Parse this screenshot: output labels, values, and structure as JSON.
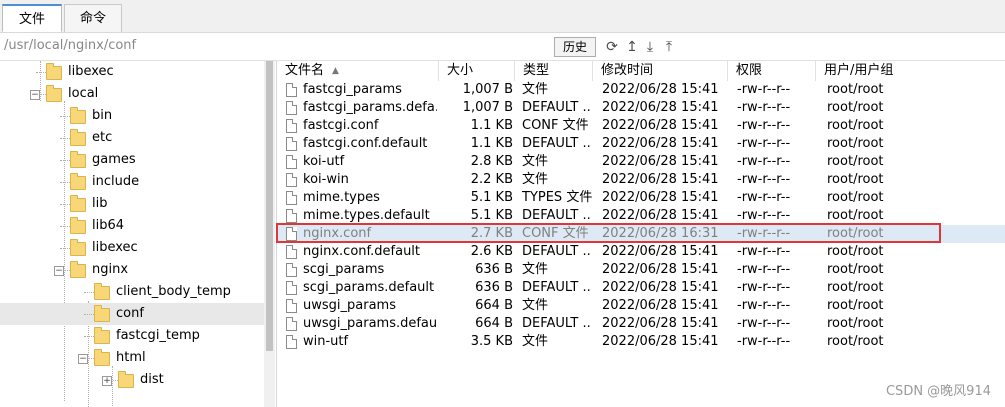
{
  "tabs": [
    {
      "label": "文件",
      "active": true
    },
    {
      "label": "命令",
      "active": false
    }
  ],
  "path": {
    "value": "/usr/local/nginx/conf"
  },
  "toolbar": {
    "history_label": "历史",
    "icons": [
      "refresh-icon",
      "upload-icon",
      "download-icon",
      "upload-alt-icon"
    ]
  },
  "tree": {
    "items": [
      {
        "label": "libexec",
        "depth": 1,
        "expander": "none"
      },
      {
        "label": "local",
        "depth": 1,
        "expander": "minus"
      },
      {
        "label": "bin",
        "depth": 2,
        "expander": "none"
      },
      {
        "label": "etc",
        "depth": 2,
        "expander": "none"
      },
      {
        "label": "games",
        "depth": 2,
        "expander": "none"
      },
      {
        "label": "include",
        "depth": 2,
        "expander": "none"
      },
      {
        "label": "lib",
        "depth": 2,
        "expander": "none"
      },
      {
        "label": "lib64",
        "depth": 2,
        "expander": "none"
      },
      {
        "label": "libexec",
        "depth": 2,
        "expander": "none"
      },
      {
        "label": "nginx",
        "depth": 2,
        "expander": "minus"
      },
      {
        "label": "client_body_temp",
        "depth": 3,
        "expander": "none"
      },
      {
        "label": "conf",
        "depth": 3,
        "expander": "none",
        "selected": true
      },
      {
        "label": "fastcgi_temp",
        "depth": 3,
        "expander": "none"
      },
      {
        "label": "html",
        "depth": 3,
        "expander": "minus"
      },
      {
        "label": "dist",
        "depth": 4,
        "expander": "plus"
      }
    ]
  },
  "columns": {
    "name": "文件名",
    "size": "大小",
    "type": "类型",
    "mtime": "修改时间",
    "perm": "权限",
    "owner": "用户/用户组"
  },
  "files": [
    {
      "name": "fastcgi_params",
      "size": "1,007 B",
      "type": "文件",
      "mtime": "2022/06/28 15:41",
      "perm": "-rw-r--r--",
      "owner": "root/root"
    },
    {
      "name": "fastcgi_params.defa...",
      "size": "1,007 B",
      "type": "DEFAULT ...",
      "mtime": "2022/06/28 15:41",
      "perm": "-rw-r--r--",
      "owner": "root/root"
    },
    {
      "name": "fastcgi.conf",
      "size": "1.1 KB",
      "type": "CONF 文件",
      "mtime": "2022/06/28 15:41",
      "perm": "-rw-r--r--",
      "owner": "root/root"
    },
    {
      "name": "fastcgi.conf.default",
      "size": "1.1 KB",
      "type": "DEFAULT ...",
      "mtime": "2022/06/28 15:41",
      "perm": "-rw-r--r--",
      "owner": "root/root"
    },
    {
      "name": "koi-utf",
      "size": "2.8 KB",
      "type": "文件",
      "mtime": "2022/06/28 15:41",
      "perm": "-rw-r--r--",
      "owner": "root/root"
    },
    {
      "name": "koi-win",
      "size": "2.2 KB",
      "type": "文件",
      "mtime": "2022/06/28 15:41",
      "perm": "-rw-r--r--",
      "owner": "root/root"
    },
    {
      "name": "mime.types",
      "size": "5.1 KB",
      "type": "TYPES 文件",
      "mtime": "2022/06/28 15:41",
      "perm": "-rw-r--r--",
      "owner": "root/root"
    },
    {
      "name": "mime.types.default",
      "size": "5.1 KB",
      "type": "DEFAULT ...",
      "mtime": "2022/06/28 15:41",
      "perm": "-rw-r--r--",
      "owner": "root/root"
    },
    {
      "name": "nginx.conf",
      "size": "2.7 KB",
      "type": "CONF 文件",
      "mtime": "2022/06/28 16:31",
      "perm": "-rw-r--r--",
      "owner": "root/root",
      "highlight": true
    },
    {
      "name": "nginx.conf.default",
      "size": "2.6 KB",
      "type": "DEFAULT ...",
      "mtime": "2022/06/28 15:41",
      "perm": "-rw-r--r--",
      "owner": "root/root"
    },
    {
      "name": "scgi_params",
      "size": "636 B",
      "type": "文件",
      "mtime": "2022/06/28 15:41",
      "perm": "-rw-r--r--",
      "owner": "root/root"
    },
    {
      "name": "scgi_params.default",
      "size": "636 B",
      "type": "DEFAULT ...",
      "mtime": "2022/06/28 15:41",
      "perm": "-rw-r--r--",
      "owner": "root/root"
    },
    {
      "name": "uwsgi_params",
      "size": "664 B",
      "type": "文件",
      "mtime": "2022/06/28 15:41",
      "perm": "-rw-r--r--",
      "owner": "root/root"
    },
    {
      "name": "uwsgi_params.default",
      "size": "664 B",
      "type": "DEFAULT ...",
      "mtime": "2022/06/28 15:41",
      "perm": "-rw-r--r--",
      "owner": "root/root"
    },
    {
      "name": "win-utf",
      "size": "3.5 KB",
      "type": "文件",
      "mtime": "2022/06/28 15:41",
      "perm": "-rw-r--r--",
      "owner": "root/root"
    }
  ],
  "watermark": "CSDN @晚风914",
  "colors": {
    "highlight_row": "#dde9f5",
    "annotation_box": "#e23636",
    "folder": "#f7d777"
  }
}
